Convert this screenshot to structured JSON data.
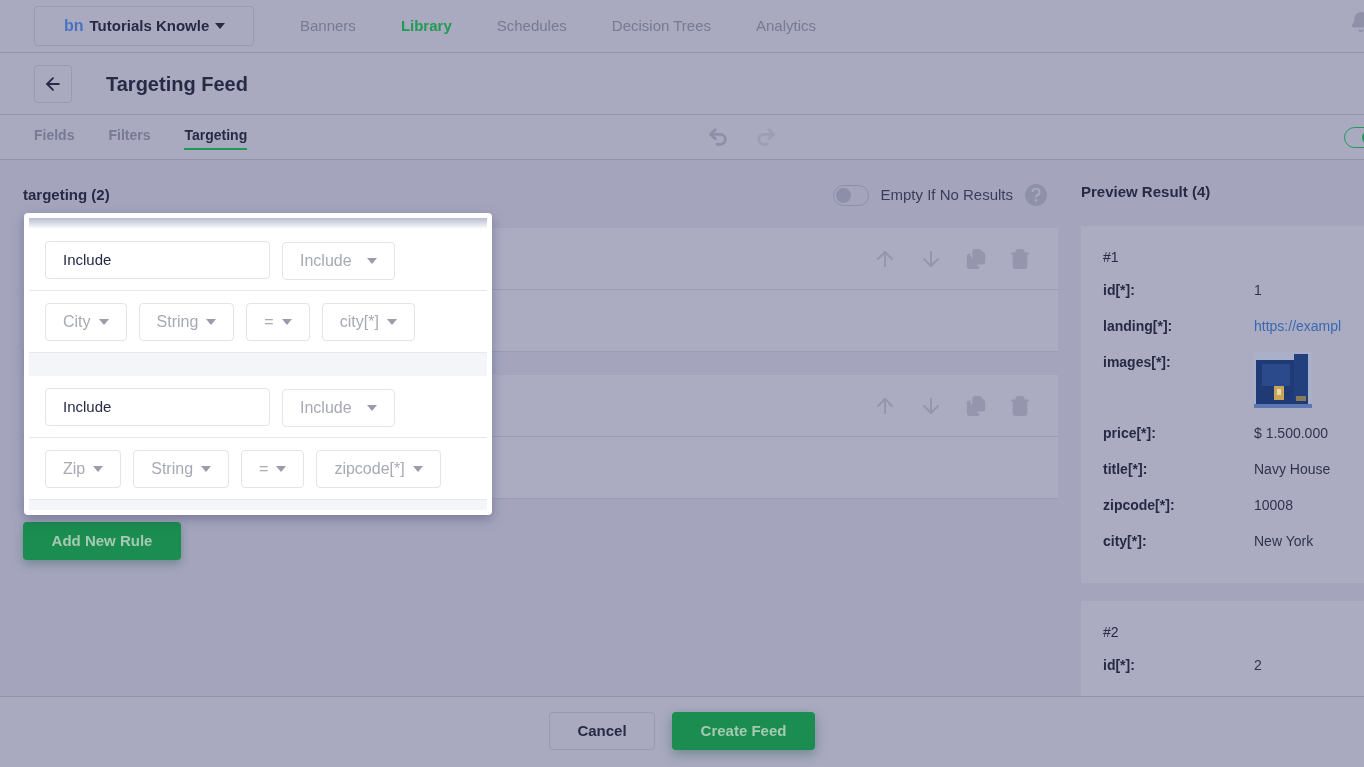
{
  "nav": {
    "workspace": {
      "logo": "bn",
      "name": "Tutorials Knowle"
    },
    "items": [
      {
        "label": "Banners",
        "selected": false
      },
      {
        "label": "Library",
        "selected": true
      },
      {
        "label": "Schedules",
        "selected": false
      },
      {
        "label": "Decision Trees",
        "selected": false
      },
      {
        "label": "Analytics",
        "selected": false
      }
    ]
  },
  "page": {
    "title": "Targeting Feed"
  },
  "tabs": [
    {
      "label": "Fields",
      "selected": false
    },
    {
      "label": "Filters",
      "selected": false
    },
    {
      "label": "Targeting",
      "selected": true
    }
  ],
  "feed_toggle": {
    "on": true
  },
  "section": {
    "title": "targeting (2)",
    "empty_if_no_results": {
      "label": "Empty If No Results",
      "on": false
    }
  },
  "rules": [
    {
      "mode_input": "Include",
      "mode_select": "Include",
      "conditions": [
        "City",
        "String",
        "=",
        "city[*]"
      ]
    },
    {
      "mode_input": "Include",
      "mode_select": "Include",
      "conditions": [
        "Zip",
        "String",
        "=",
        "zipcode[*]"
      ]
    }
  ],
  "add_rule_button": "Add New Rule",
  "preview": {
    "title": "Preview Result (4)",
    "results": [
      {
        "heading": "#1",
        "fields": [
          {
            "key": "id[*]:",
            "kind": "text",
            "value": "1"
          },
          {
            "key": "landing[*]:",
            "kind": "link",
            "value": "https://exampl"
          },
          {
            "key": "images[*]:",
            "kind": "picture"
          },
          {
            "key": "price[*]:",
            "kind": "text",
            "value": "$ 1.500.000"
          },
          {
            "key": "title[*]:",
            "kind": "text",
            "value": "Navy House"
          },
          {
            "key": "zipcode[*]:",
            "kind": "text",
            "value": "10008"
          },
          {
            "key": "city[*]:",
            "kind": "text",
            "value": "New York"
          }
        ]
      },
      {
        "heading": "#2",
        "fields": [
          {
            "key": "id[*]:",
            "kind": "text",
            "value": "2"
          }
        ]
      }
    ]
  },
  "footer": {
    "buttons": [
      {
        "label": "Cancel",
        "kind": "secondary"
      },
      {
        "label": "Create Feed",
        "kind": "primary"
      }
    ]
  }
}
